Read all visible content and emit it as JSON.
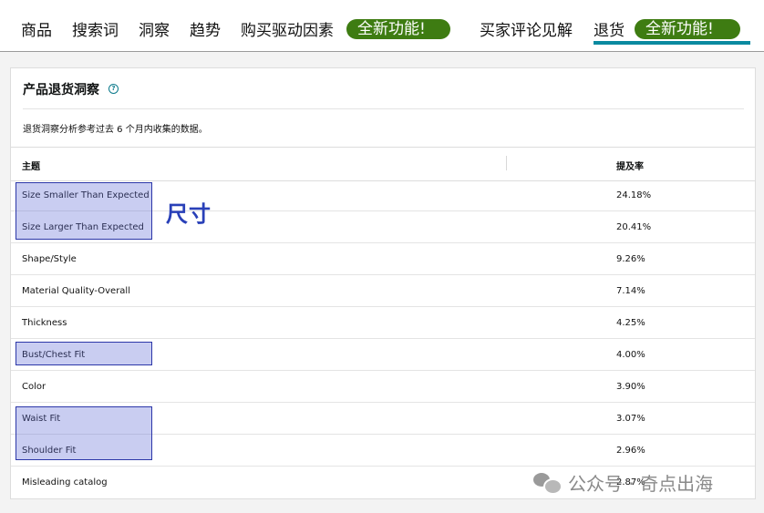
{
  "nav": {
    "tabs": [
      {
        "label": "商品"
      },
      {
        "label": "搜索词"
      },
      {
        "label": "洞察"
      },
      {
        "label": "趋势"
      },
      {
        "label": "购买驱动因素"
      },
      {
        "label": "买家评论见解"
      },
      {
        "label": "退货"
      }
    ],
    "badges": [
      "全新功能!",
      "全新功能!"
    ],
    "active_tab": "退货"
  },
  "card": {
    "title": "产品退货洞察",
    "help_icon": "?",
    "subtitle": "退货洞察分析参考过去 6 个月内收集的数据。",
    "columns": {
      "topic": "主题",
      "rate": "提及率"
    },
    "rows": [
      {
        "topic": "Size Smaller Than Expected",
        "rate": "24.18%",
        "highlighted": true
      },
      {
        "topic": "Size Larger Than Expected",
        "rate": "20.41%",
        "highlighted": true
      },
      {
        "topic": "Shape/Style",
        "rate": "9.26%",
        "highlighted": false
      },
      {
        "topic": "Material Quality-Overall",
        "rate": "7.14%",
        "highlighted": false
      },
      {
        "topic": "Thickness",
        "rate": "4.25%",
        "highlighted": false
      },
      {
        "topic": "Bust/Chest Fit",
        "rate": "4.00%",
        "highlighted": true
      },
      {
        "topic": "Color",
        "rate": "3.90%",
        "highlighted": false
      },
      {
        "topic": "Waist Fit",
        "rate": "3.07%",
        "highlighted": true
      },
      {
        "topic": "Shoulder Fit",
        "rate": "2.96%",
        "highlighted": true
      },
      {
        "topic": "Misleading catalog",
        "rate": "2.87%",
        "highlighted": false
      }
    ]
  },
  "annotation": {
    "label": "尺寸",
    "color": "#2940b8"
  },
  "watermark": {
    "text": "公众号 · 奇点出海",
    "icon": "wechat-icon"
  },
  "colors": {
    "badge": "#3e7c12",
    "active_underline": "#0a8aa0",
    "highlight": "#5c66d6"
  }
}
